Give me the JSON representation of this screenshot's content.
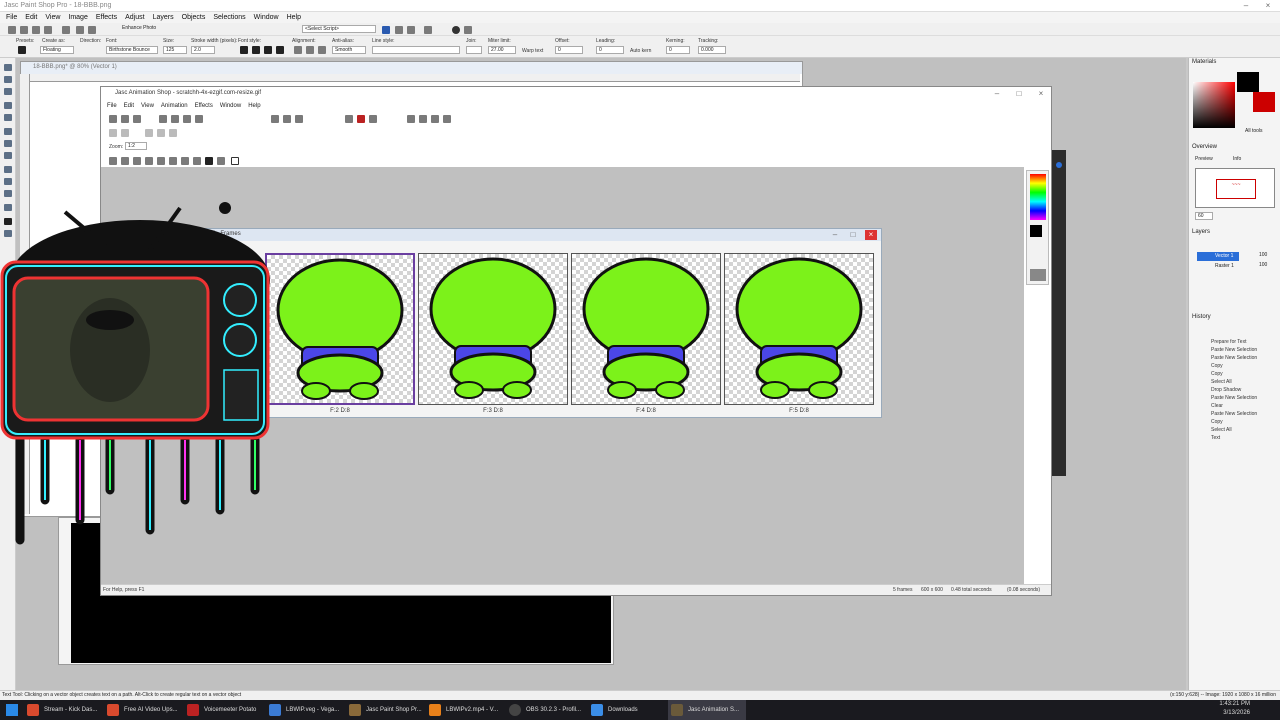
{
  "main_window": {
    "title": "Jasc Paint Shop Pro - 18-BBB.png",
    "menus": [
      "File",
      "Edit",
      "View",
      "Image",
      "Effects",
      "Adjust",
      "Layers",
      "Objects",
      "Selections",
      "Window",
      "Help"
    ]
  },
  "toolbar": {
    "enhance_photo": "Enhance Photo",
    "select_script": "<Select Script>",
    "presets_label": "Presets:",
    "create_as_label": "Create as:",
    "create_as_value": "Floating",
    "direction_label": "Direction:",
    "font_label": "Font:",
    "font_value": "Birthstone Bounce",
    "size_label": "Size:",
    "size_value": "125",
    "stroke_label": "Stroke width (pixels):",
    "stroke_value": "2.0",
    "font_style_label": "Font style:",
    "alignment_label": "Alignment:",
    "anti_alias_label": "Anti-alias:",
    "anti_alias_value": "Smooth",
    "line_style_label": "Line style:",
    "join_label": "Join:",
    "miter_label": "Miter limit:",
    "miter_value": "27.00",
    "warp_text": "Warp text",
    "offset_label": "Offset:",
    "offset_value": "0",
    "leading_label": "Leading:",
    "leading_value": "0",
    "auto_kern": "Auto kern",
    "kerning_label": "Kerning:",
    "kerning_value": "0",
    "tracking_label": "Tracking:",
    "tracking_value": "0.000"
  },
  "psp_doc": {
    "title": "18-BBB.png* @ 80% (Vector 1)"
  },
  "animation_shop": {
    "title": "Jasc Animation Shop - scratchh-4x-ezgif.com-resize.gif",
    "menus": [
      "File",
      "Edit",
      "View",
      "Animation",
      "Effects",
      "Window",
      "Help"
    ],
    "zoom_label": "Zoom:",
    "zoom_value": "1:2",
    "status_left": "For Help, press F1",
    "status_frames": "5 frames",
    "status_size": "600 x 600",
    "status_time": "0.48 total seconds",
    "status_time2": "(0.08 seconds)"
  },
  "frames_window": {
    "title": "scratchh-4x-ezgif.com-resize.gif [1:2] - Frames",
    "frames": [
      {
        "label": "F:2  D:8"
      },
      {
        "label": "F:3  D:8"
      },
      {
        "label": "F:4  D:8"
      },
      {
        "label": "F:5  D:8"
      }
    ]
  },
  "right_panel": {
    "materials": "Materials",
    "all_tools": "All tools",
    "overview": "Overview",
    "preview_tab": "Preview",
    "info_tab": "Info",
    "zoom_value": "60",
    "layers": "Layers",
    "layer_items": [
      {
        "name": "Vector 1",
        "opacity": "100"
      },
      {
        "name": "Raster 1",
        "opacity": "100"
      }
    ],
    "history": "History",
    "history_items": [
      "Prepare for Text",
      "Paste New Selection",
      "Paste New Selection",
      "Copy",
      "Copy",
      "Select All",
      "Drop Shadow",
      "Paste New Selection",
      "Clear",
      "Paste New Selection",
      "Copy",
      "Select All",
      "Text"
    ]
  },
  "status": {
    "left": "Text Tool: Clicking on a vector object creates text on a path. Alt-Click to create regular text on a vector object",
    "right": "(x:150 y:628) -- Image: 1920 x 1080 x 16 million"
  },
  "taskbar": {
    "items": [
      {
        "label": "Stream - Kick Das...",
        "color": "#d94a2e"
      },
      {
        "label": "Free AI Video Ups...",
        "color": "#d94a2e"
      },
      {
        "label": "Voicemeeter Potato",
        "color": "#b22"
      },
      {
        "label": "LBWIP.veg - Vega...",
        "color": "#3b7bd4"
      },
      {
        "label": "Jasc Paint Shop Pr...",
        "color": "#8a6a3a"
      },
      {
        "label": "LBWIPv2.mp4 - V...",
        "color": "#e8801a"
      },
      {
        "label": "OBS 30.2.3 - Profil...",
        "color": "#444"
      },
      {
        "label": "Downloads",
        "color": "#3b8ee8"
      },
      {
        "label": "Jasc Animation S...",
        "color": "#6a5a3a"
      }
    ],
    "time": "1:43:21 PM",
    "date": "3/13/2026"
  },
  "colors": {
    "accent_purple": "#6a3ea0",
    "frog_green": "#7cf21a",
    "shirt_blue": "#4b46e8"
  }
}
